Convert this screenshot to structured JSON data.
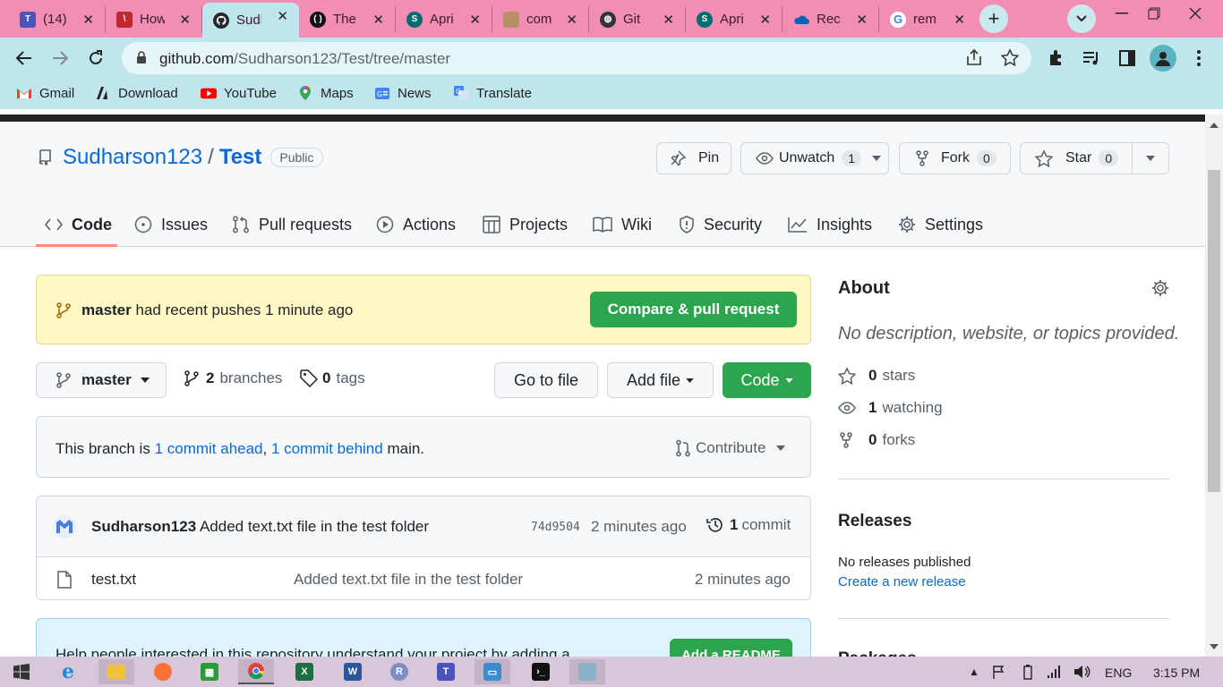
{
  "browser": {
    "tabs": [
      {
        "title": "(14)",
        "color": "#4b53bc",
        "glyph": "T"
      },
      {
        "title": "How",
        "color": "#c4262e",
        "glyph": "\\"
      },
      {
        "title": "Sudh",
        "color": "#24292f",
        "glyph": "●"
      },
      {
        "title": "The",
        "color": "#111111",
        "glyph": "⁽⁾"
      },
      {
        "title": "Apri",
        "color": "#036c70",
        "glyph": "S"
      },
      {
        "title": "com",
        "color": "#b89066",
        "glyph": "▮"
      },
      {
        "title": "Git",
        "color": "#333333",
        "glyph": "◍"
      },
      {
        "title": "Apri",
        "color": "#036c70",
        "glyph": "S"
      },
      {
        "title": "Rec",
        "color": "#0364b8",
        "glyph": "☁"
      },
      {
        "title": "rem",
        "color": "#4285f4",
        "glyph": "G"
      }
    ],
    "url_host": "github.com",
    "url_path": "/Sudharson123/Test/tree/master",
    "bookmarks": [
      {
        "label": "Gmail",
        "icon": "gmail-icon"
      },
      {
        "label": "Download",
        "icon": "download-icon"
      },
      {
        "label": "YouTube",
        "icon": "youtube-icon"
      },
      {
        "label": "Maps",
        "icon": "maps-icon"
      },
      {
        "label": "News",
        "icon": "news-icon"
      },
      {
        "label": "Translate",
        "icon": "translate-icon"
      }
    ]
  },
  "repo": {
    "owner": "Sudharson123",
    "separator": "/",
    "name": "Test",
    "visibility": "Public",
    "pin_label": "Pin",
    "unwatch_label": "Unwatch",
    "unwatch_count": "1",
    "fork_label": "Fork",
    "fork_count": "0",
    "star_label": "Star",
    "star_count": "0"
  },
  "nav": {
    "code": "Code",
    "issues": "Issues",
    "pulls": "Pull requests",
    "actions": "Actions",
    "projects": "Projects",
    "wiki": "Wiki",
    "security": "Security",
    "insights": "Insights",
    "settings": "Settings"
  },
  "banner": {
    "branch": "master",
    "text": "had recent pushes 1 minute ago",
    "button": "Compare & pull request"
  },
  "branchbar": {
    "branch": "master",
    "branches_count": "2",
    "branches_label": "branches",
    "tags_count": "0",
    "tags_label": "tags",
    "goto": "Go to file",
    "addfile": "Add file",
    "code": "Code"
  },
  "compare": {
    "prefix": "This branch is",
    "ahead": "1 commit ahead",
    "comma": ",",
    "behind": "1 commit behind",
    "suffix": "main.",
    "contribute": "Contribute"
  },
  "commit": {
    "author": "Sudharson123",
    "message": "Added text.txt file in the test folder",
    "sha": "74d9504",
    "time": "2 minutes ago",
    "count": "1",
    "count_label": "commit"
  },
  "files": [
    {
      "name": "test.txt",
      "message": "Added text.txt file in the test folder",
      "time": "2 minutes ago"
    }
  ],
  "readme": {
    "text": "Help people interested in this repository understand your project by adding a",
    "button": "Add a README"
  },
  "about": {
    "title": "About",
    "description": "No description, website, or topics provided.",
    "stars_count": "0",
    "stars_label": "stars",
    "watching_count": "1",
    "watching_label": "watching",
    "forks_count": "0",
    "forks_label": "forks",
    "releases_title": "Releases",
    "releases_none": "No releases published",
    "releases_create": "Create a new release",
    "packages_title": "Packages"
  },
  "system": {
    "lang": "ENG",
    "time": "3:15 PM"
  }
}
